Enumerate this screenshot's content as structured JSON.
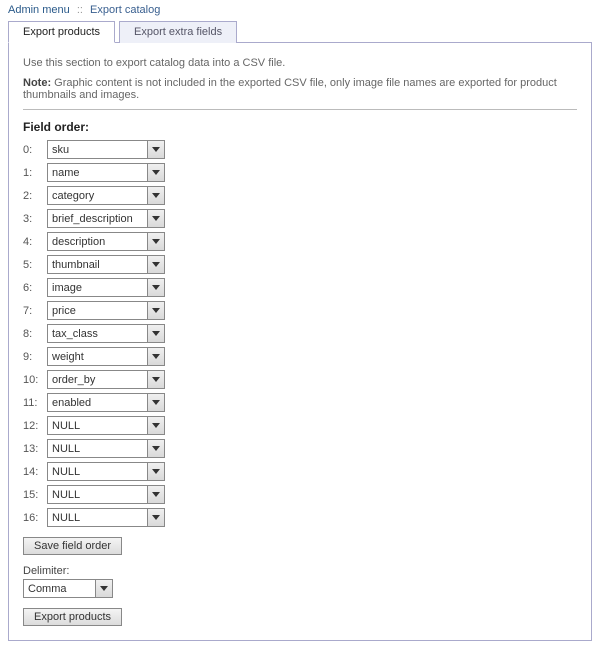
{
  "breadcrumb": {
    "home": "Admin menu",
    "sep": "::",
    "current": "Export catalog"
  },
  "tabs": {
    "products": "Export products",
    "extra": "Export extra fields"
  },
  "intro": "Use this section to export catalog data into a CSV file.",
  "note_bold": "Note:",
  "note_text": " Graphic content is not included in the exported CSV file, only image file names are exported for product thumbnails and images.",
  "fieldorder_title": "Field order:",
  "fields": [
    {
      "idx": "0:",
      "value": "sku"
    },
    {
      "idx": "1:",
      "value": "name"
    },
    {
      "idx": "2:",
      "value": "category"
    },
    {
      "idx": "3:",
      "value": "brief_description"
    },
    {
      "idx": "4:",
      "value": "description"
    },
    {
      "idx": "5:",
      "value": "thumbnail"
    },
    {
      "idx": "6:",
      "value": "image"
    },
    {
      "idx": "7:",
      "value": "price"
    },
    {
      "idx": "8:",
      "value": "tax_class"
    },
    {
      "idx": "9:",
      "value": "weight"
    },
    {
      "idx": "10:",
      "value": "order_by"
    },
    {
      "idx": "11:",
      "value": "enabled"
    },
    {
      "idx": "12:",
      "value": "NULL"
    },
    {
      "idx": "13:",
      "value": "NULL"
    },
    {
      "idx": "14:",
      "value": "NULL"
    },
    {
      "idx": "15:",
      "value": "NULL"
    },
    {
      "idx": "16:",
      "value": "NULL"
    }
  ],
  "save_btn": "Save field order",
  "delimiter_label": "Delimiter:",
  "delimiter_value": "Comma",
  "export_btn": "Export products"
}
